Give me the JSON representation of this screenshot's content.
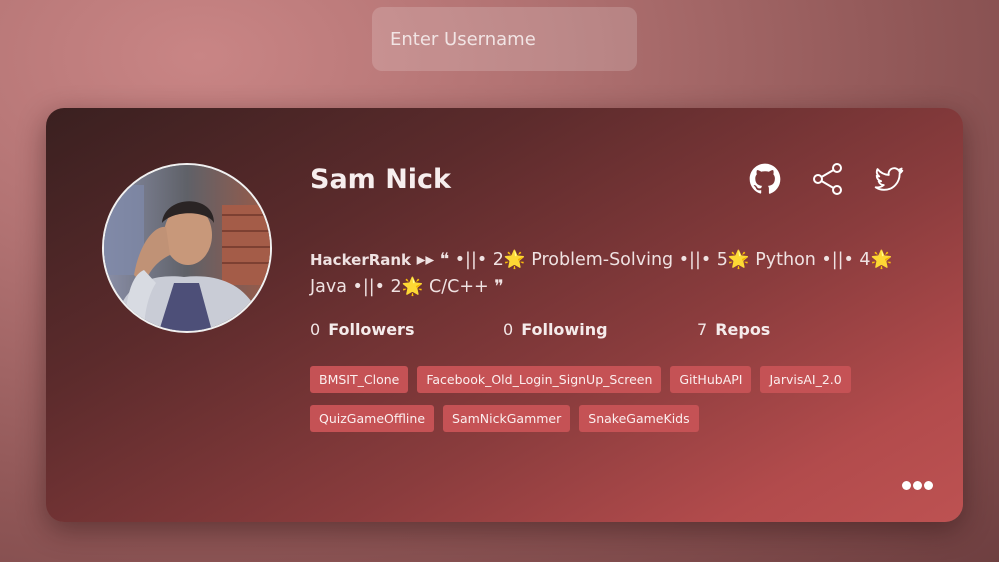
{
  "search": {
    "placeholder": "Enter Username"
  },
  "profile": {
    "name": "Sam Nick",
    "avatar_icon": "user-photo",
    "bio": {
      "brand": "HackerRank",
      "text": " ▸▸ ❝ •||• 2🌟 Problem-Solving •||• 5🌟 Python •||• 4🌟 Java •||• 2🌟 C/C++ ❞"
    },
    "stats": [
      {
        "value": "0",
        "label": "Followers"
      },
      {
        "value": "0",
        "label": "Following"
      },
      {
        "value": "7",
        "label": "Repos"
      }
    ],
    "repos": [
      "BMSIT_Clone",
      "Facebook_Old_Login_SignUp_Screen",
      "GitHubAPI",
      "JarvisAI_2.0",
      "QuizGameOffline",
      "SamNickGammer",
      "SnakeGameKids"
    ]
  },
  "icons": {
    "github": "github-icon",
    "share": "share-icon",
    "twitter": "twitter-icon",
    "more": "more-dots-icon"
  },
  "colors": {
    "repo_tag": "#c55255",
    "card_start": "#3a2020",
    "card_end": "#bd5252",
    "background": "#b17272"
  }
}
